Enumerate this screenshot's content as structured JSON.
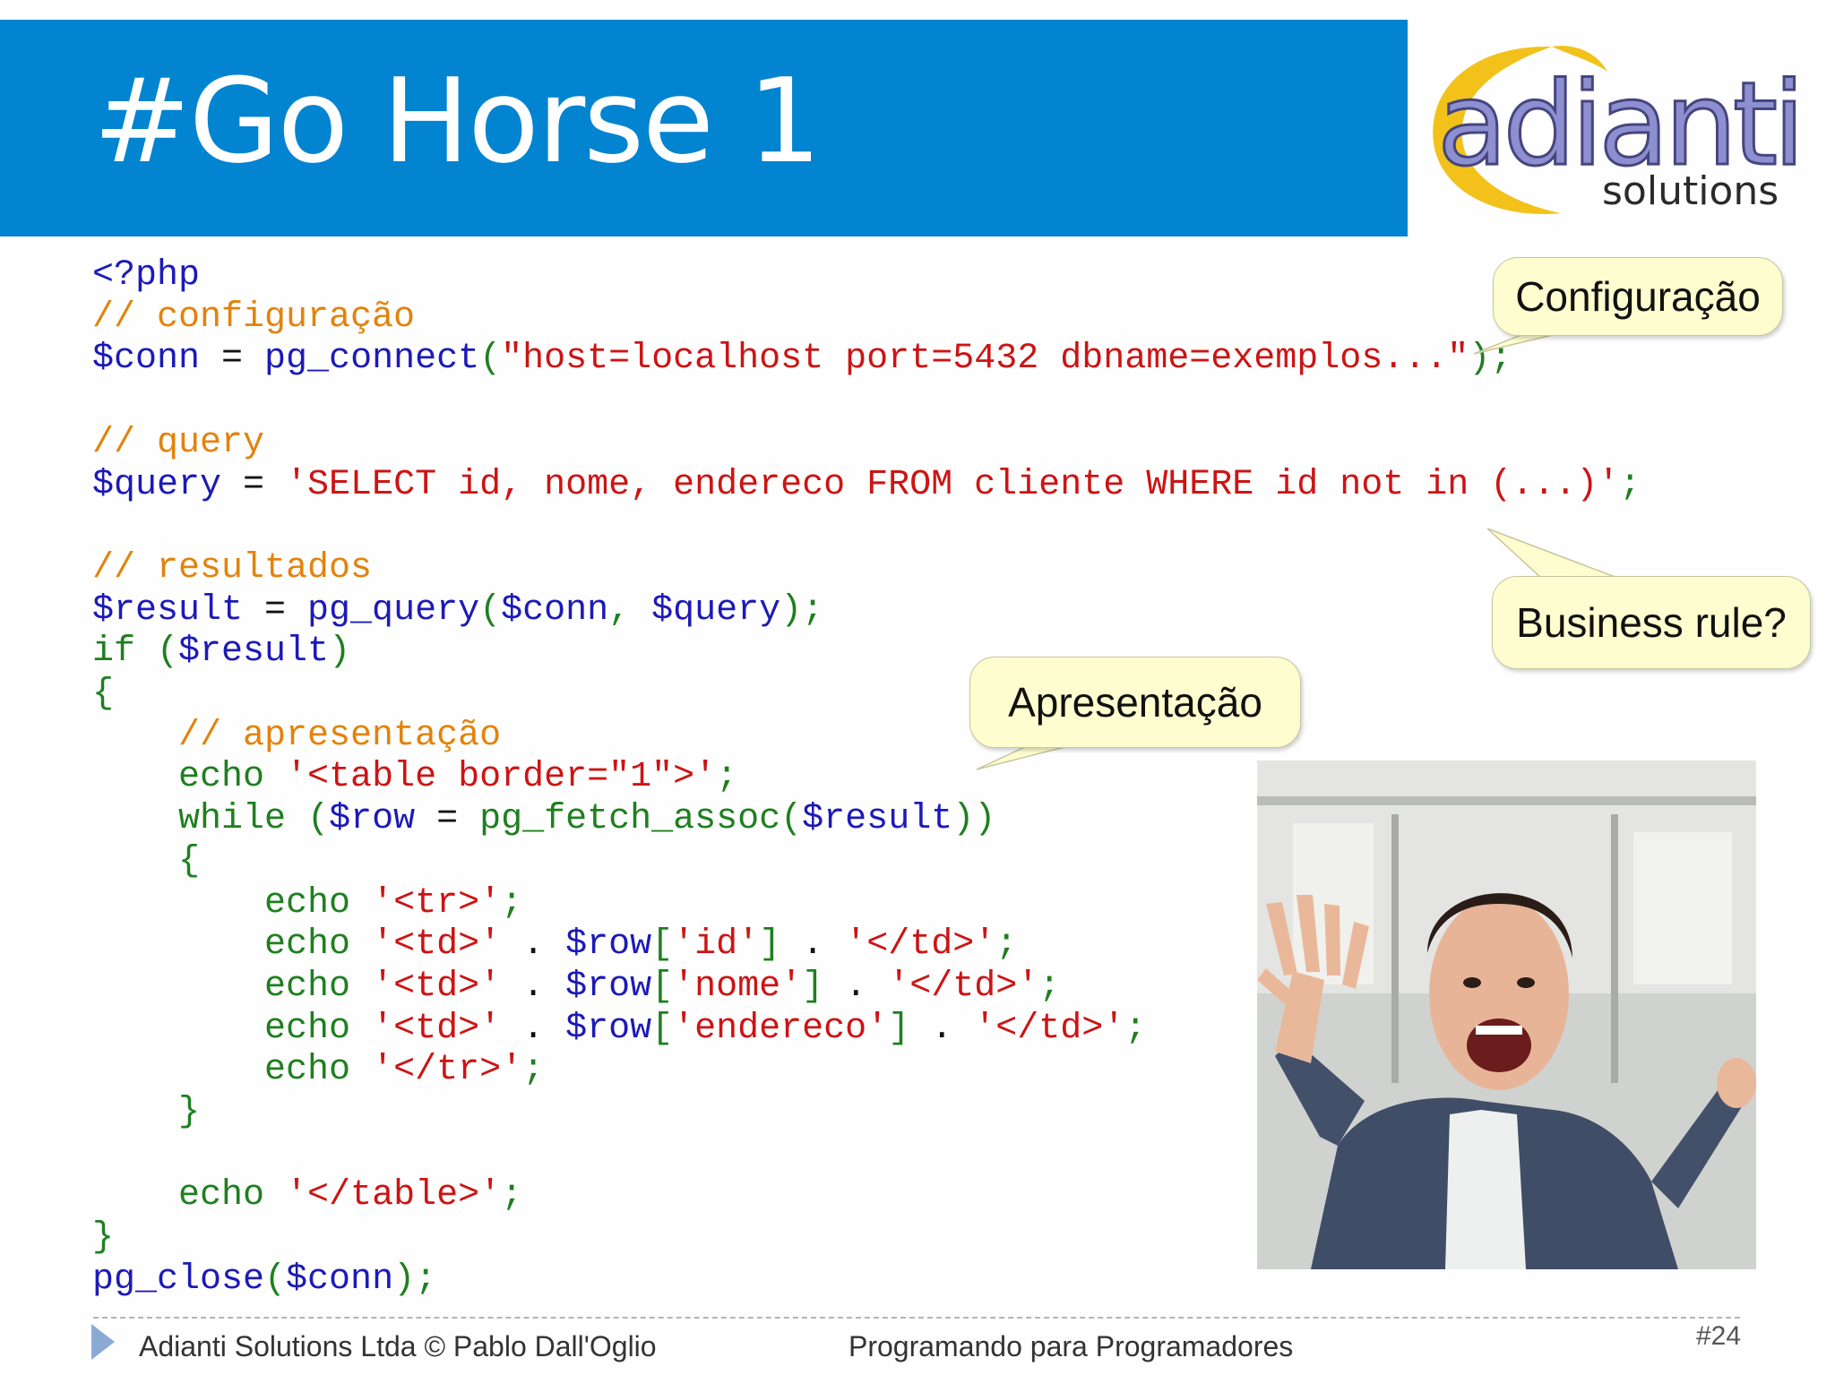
{
  "slide": {
    "title": "#Go Horse 1",
    "page_number": "#24"
  },
  "logo": {
    "word": "adianti",
    "sub": "solutions"
  },
  "code": {
    "line1": "<?php",
    "line2": "// configuração",
    "line3": {
      "var": "$conn",
      "op": " = ",
      "fn": "pg_connect",
      "open": "(",
      "str": "\"host=localhost port=5432 dbname=exemplos...\"",
      "close": ");"
    },
    "line5": "// query",
    "line6": {
      "var": "$query",
      "op": " = ",
      "str": "'SELECT id, nome, endereco FROM cliente WHERE id not in (...)'",
      "semi": ";"
    },
    "line8": "// resultados",
    "line9": {
      "var": "$result",
      "op": " = ",
      "fn": "pg_query",
      "open": "(",
      "a1": "$conn",
      "comma": ", ",
      "a2": "$query",
      "close": ");"
    },
    "line10": {
      "kw": "if",
      "open": " (",
      "var": "$result",
      "close": ")"
    },
    "line11": "{",
    "line12": "// apresentação",
    "line13": {
      "kw": "echo",
      "sp": " ",
      "str": "'<table border=\"1\">'",
      "semi": ";"
    },
    "line14": {
      "kw": "while",
      "open": " (",
      "var": "$row",
      "op": " = ",
      "fn": "pg_fetch_assoc",
      "open2": "(",
      "var2": "$result",
      "close": "))"
    },
    "line15": "{",
    "line16": {
      "kw": "echo",
      "sp": " ",
      "str": "'<tr>'",
      "semi": ";"
    },
    "line17": {
      "kw": "echo",
      "sp": " ",
      "str1": "'<td>'",
      "dot1": " . ",
      "var": "$row",
      "br1": "[",
      "key": "'id'",
      "br2": "]",
      "dot2": " . ",
      "str2": "'</td>'",
      "semi": ";"
    },
    "line18": {
      "kw": "echo",
      "sp": " ",
      "str1": "'<td>'",
      "dot1": " . ",
      "var": "$row",
      "br1": "[",
      "key": "'nome'",
      "br2": "]",
      "dot2": " . ",
      "str2": "'</td>'",
      "semi": ";"
    },
    "line19": {
      "kw": "echo",
      "sp": " ",
      "str1": "'<td>'",
      "dot1": " . ",
      "var": "$row",
      "br1": "[",
      "key": "'endereco'",
      "br2": "]",
      "dot2": " . ",
      "str2": "'</td>'",
      "semi": ";"
    },
    "line20": {
      "kw": "echo",
      "sp": " ",
      "str": "'</tr>'",
      "semi": ";"
    },
    "line21": "}",
    "line23": {
      "kw": "echo",
      "sp": " ",
      "str": "'</table>'",
      "semi": ";"
    },
    "line24": "}",
    "line25": {
      "fn": "pg_close",
      "open": "(",
      "var": "$conn",
      "close": ");"
    }
  },
  "callouts": {
    "config": "Configuração",
    "business": "Business rule?",
    "presentation": "Apresentação"
  },
  "footer": {
    "left": "Adianti Solutions Ltda © Pablo Dall'Oglio",
    "center": "Programando para Programadores"
  },
  "colors": {
    "title_bar": "#0284d0",
    "code_variable": "#1c1ab7",
    "code_keyword": "#1f7f1f",
    "code_string": "#cc1414",
    "code_comment": "#e2830c",
    "callout_fill": "#fdfdcf"
  }
}
